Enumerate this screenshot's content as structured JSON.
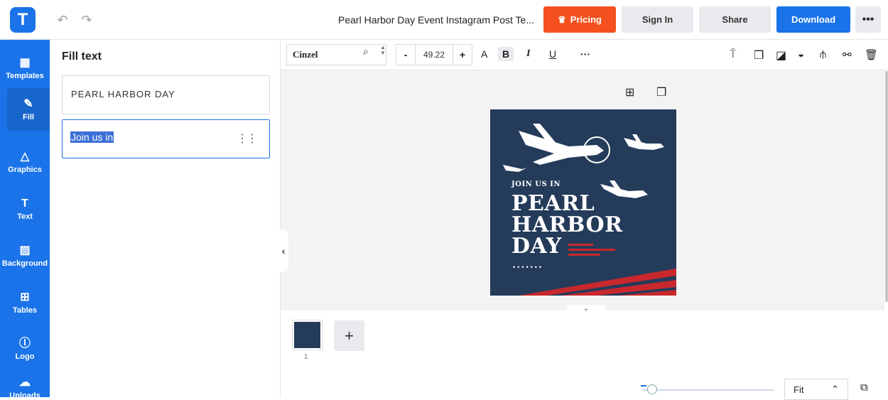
{
  "header": {
    "logo_letter": "T",
    "doc_title": "Pearl Harbor Day Event Instagram Post Te...",
    "pricing_label": "Pricing",
    "signin_label": "Sign In",
    "share_label": "Share",
    "download_label": "Download",
    "more_label": "•••"
  },
  "sidebar": {
    "items": [
      {
        "label": "Templates",
        "icon": "▦"
      },
      {
        "label": "Fill",
        "icon": "✎"
      },
      {
        "label": "Graphics",
        "icon": "△"
      },
      {
        "label": "Text",
        "icon": "T"
      },
      {
        "label": "Background",
        "icon": "▨"
      },
      {
        "label": "Tables",
        "icon": "⊞"
      },
      {
        "label": "Logo",
        "icon": "ⓛ"
      },
      {
        "label": "Uploads",
        "icon": "☁"
      }
    ]
  },
  "panel": {
    "title": "Fill text",
    "fields": [
      {
        "value": "PEARL HARBOR DAY"
      },
      {
        "value": "Join us in"
      }
    ]
  },
  "toolbar": {
    "font": "Cinzel",
    "font_size": "49.22",
    "minus": "-",
    "plus": "+",
    "case_icon": "A",
    "bold_icon": "B",
    "italic_icon": "I",
    "underline_icon": "U",
    "more_icon": "···"
  },
  "poster": {
    "join_text": "JOIN US IN",
    "title_line1": "PEARL",
    "title_line2": "HARBOR",
    "title_line3": "DAY",
    "dots": "•••••••",
    "bg_color": "#243b5a",
    "accent_color": "#c8282d"
  },
  "pages": {
    "thumb_number": "1",
    "add_label": "+"
  },
  "zoom": {
    "mode": "Fit"
  },
  "colors": {
    "brand_blue": "#1a73e8",
    "pricing_orange": "#f4511e"
  }
}
